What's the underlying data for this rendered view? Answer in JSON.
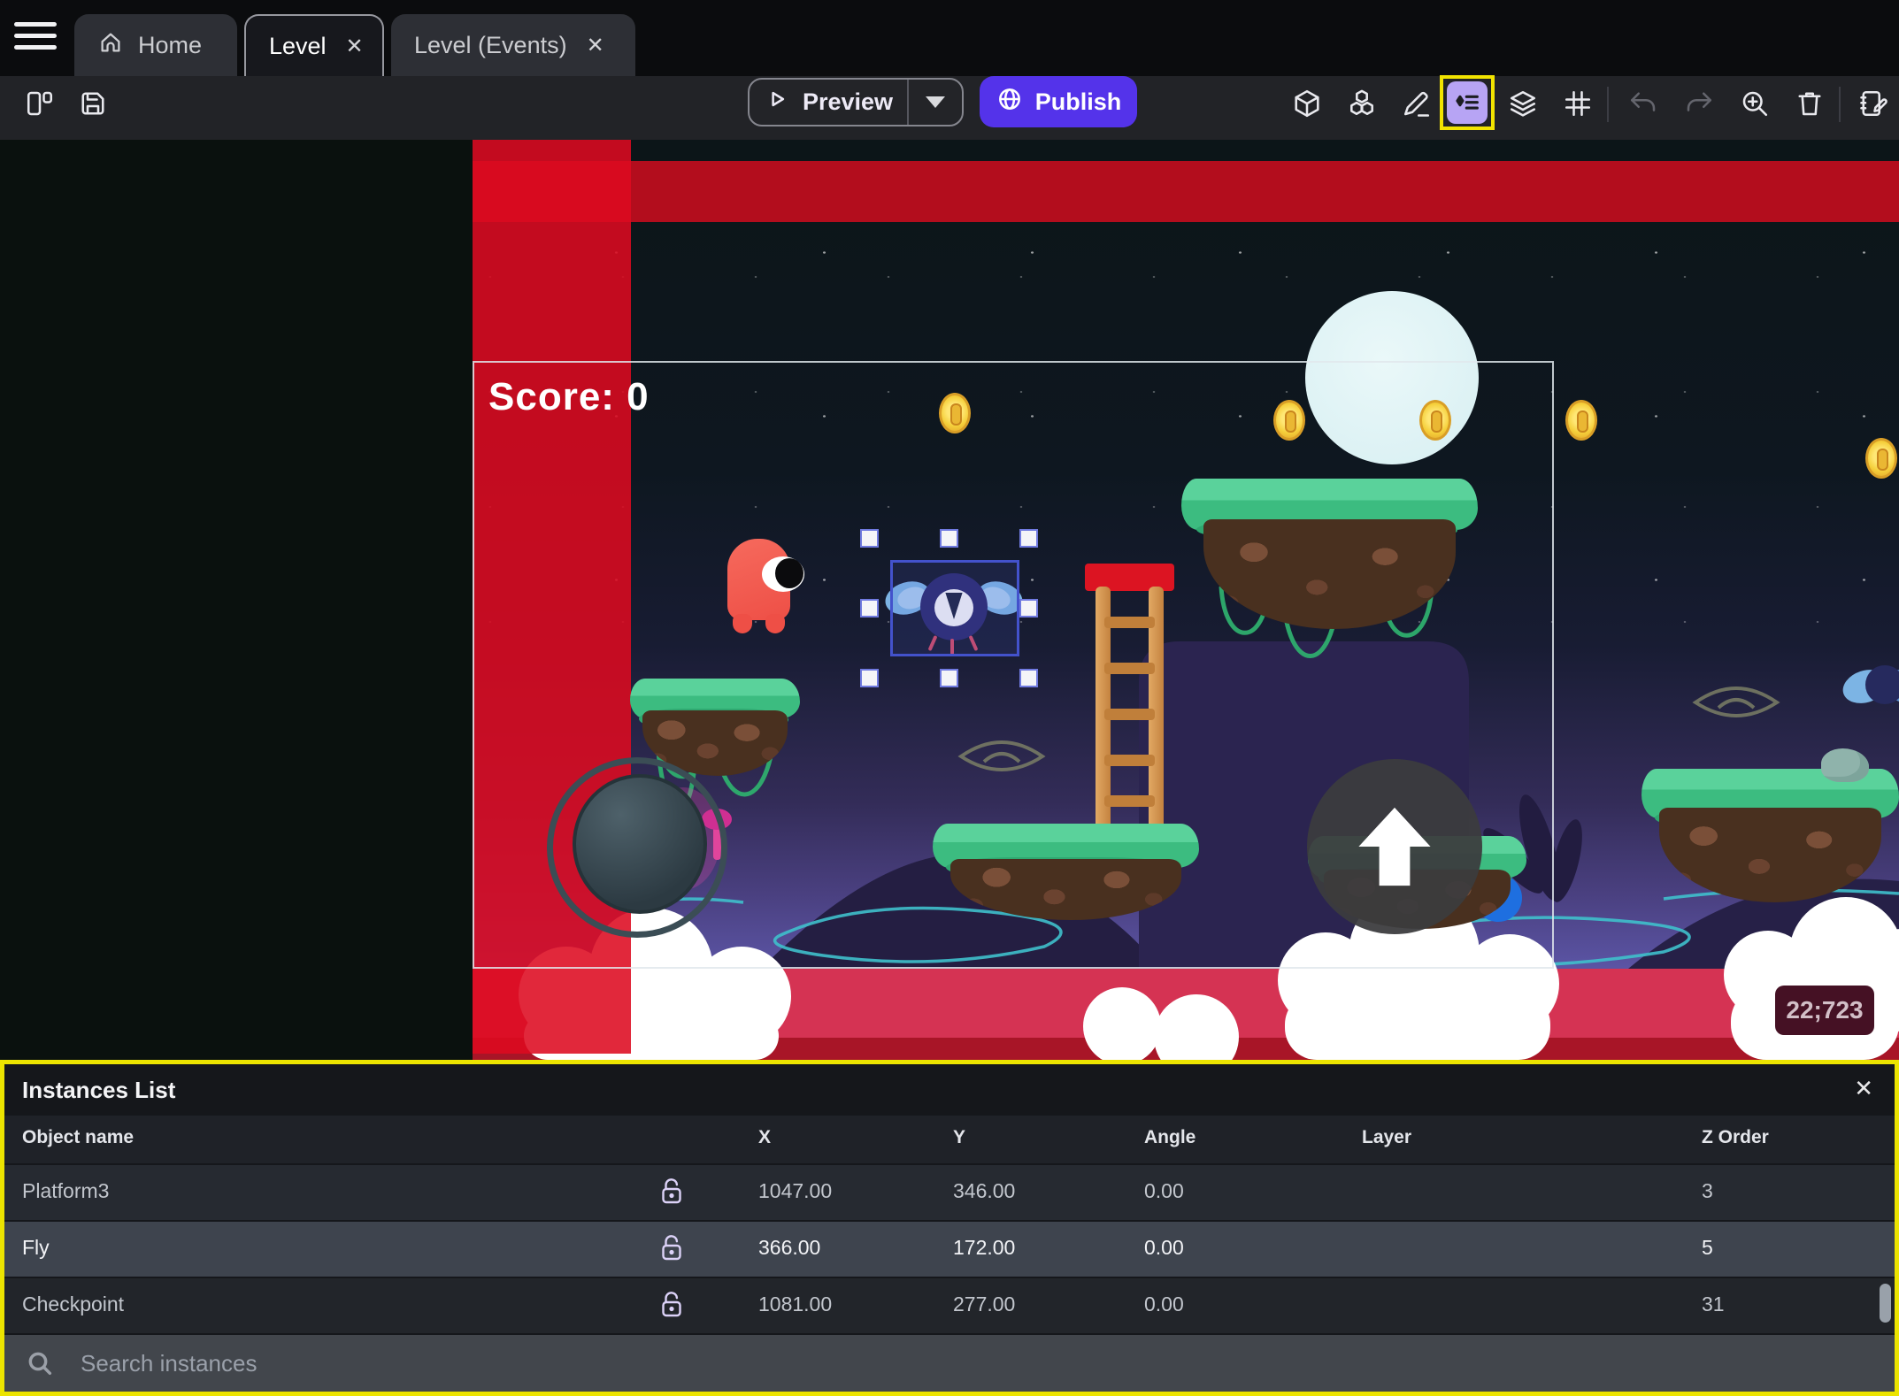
{
  "tabs": {
    "home": "Home",
    "level": "Level",
    "events": "Level (Events)",
    "close_glyph": "✕"
  },
  "toolbar": {
    "preview_label": "Preview",
    "publish_label": "Publish"
  },
  "scene": {
    "score_text": "Score: 0",
    "coords_badge": "22;723"
  },
  "instances": {
    "title": "Instances List",
    "close_glyph": "✕",
    "search_placeholder": "Search instances",
    "columns": [
      "Object name",
      "X",
      "Y",
      "Angle",
      "Layer",
      "Z Order"
    ],
    "rows": [
      {
        "name": "Platform3",
        "x": "1047.00",
        "y": "346.00",
        "angle": "0.00",
        "layer": "",
        "z": "3"
      },
      {
        "name": "Fly",
        "x": "366.00",
        "y": "172.00",
        "angle": "0.00",
        "layer": "",
        "z": "5"
      },
      {
        "name": "Checkpoint",
        "x": "1081.00",
        "y": "277.00",
        "angle": "0.00",
        "layer": "",
        "z": "31"
      }
    ]
  },
  "icons": {
    "hamburger": "≡",
    "home": "⌂",
    "close": "✕",
    "play": "▷",
    "chevron_down": "▾",
    "globe": "◍",
    "cube": "⬡",
    "cubes": "⬡⬡",
    "pen": "✎",
    "instances_list": "◆≡",
    "layers": "≋",
    "grid": "#",
    "undo": "↶",
    "redo": "↷",
    "zoom_in": "⊕",
    "trash": "🗑",
    "edit_panel": "🗒",
    "search": "⌕",
    "lock_open": "🔓"
  },
  "colors": {
    "accent_purple": "#5433ea",
    "highlight_purple": "#b7a4f4",
    "annotation_yellow": "#ece400",
    "red_strip": "#dd0a20",
    "selected_row": "#3e444e",
    "toolbar_bg": "#222327"
  }
}
